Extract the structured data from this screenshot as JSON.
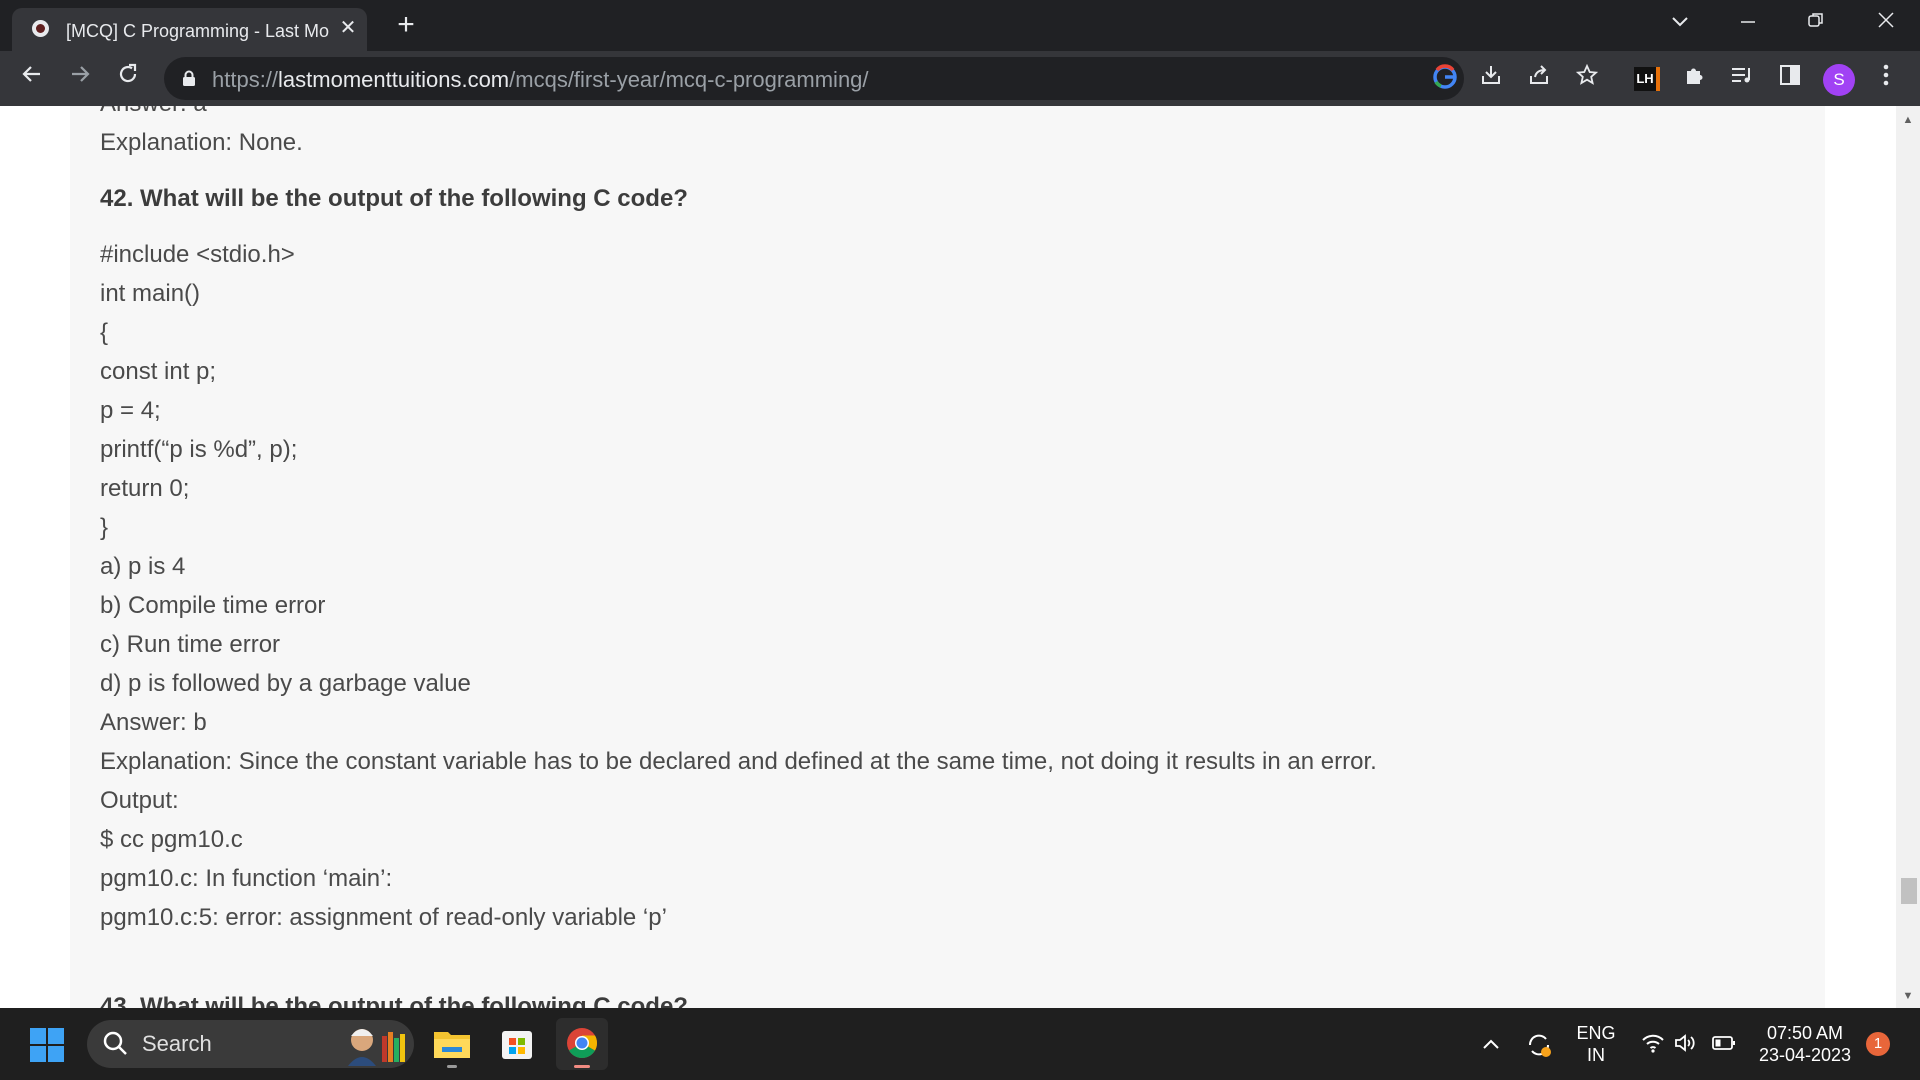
{
  "browser": {
    "tab_title": "[MCQ] C Programming - Last Mo",
    "url_scheme": "https://",
    "url_host": "lastmomenttuitions.com",
    "url_path": "/mcqs/first-year/mcq-c-programming/",
    "profile_initial": "S",
    "extension_badge": "LH"
  },
  "article": {
    "partial_top": "Answer: a",
    "prev_explanation": "Explanation: None.",
    "question": "42. What will be the output of the following C code?",
    "code": [
      "#include <stdio.h>",
      "int main()",
      "{",
      "const int p;",
      "p = 4;",
      "printf(“p is %d”, p);",
      "return 0;",
      "}"
    ],
    "options": [
      "a) p is 4",
      "b) Compile time error",
      "c) Run time error",
      "d) p is followed by a garbage value"
    ],
    "answer": "Answer: b",
    "explanation": "Explanation: Since the constant variable has to be declared and defined at the same time, not doing it results in an error.",
    "output_label": "Output:",
    "output_lines": [
      "$ cc pgm10.c",
      "pgm10.c: In function ‘main’:",
      "pgm10.c:5: error: assignment of read-only variable ‘p’"
    ],
    "partial_bottom": "43. What will be the output of the following C code?"
  },
  "taskbar": {
    "search_label": "Search",
    "lang_top": "ENG",
    "lang_bottom": "IN",
    "time": "07:50 AM",
    "date": "23-04-2023",
    "notification_count": "1"
  },
  "colors": {
    "titlebar": "#202124",
    "toolbar": "#35363a",
    "article_bg": "#f7f7f7",
    "text": "#4a4a4a",
    "taskbar": "#1f1f1f",
    "avatar": "#a142f4"
  }
}
